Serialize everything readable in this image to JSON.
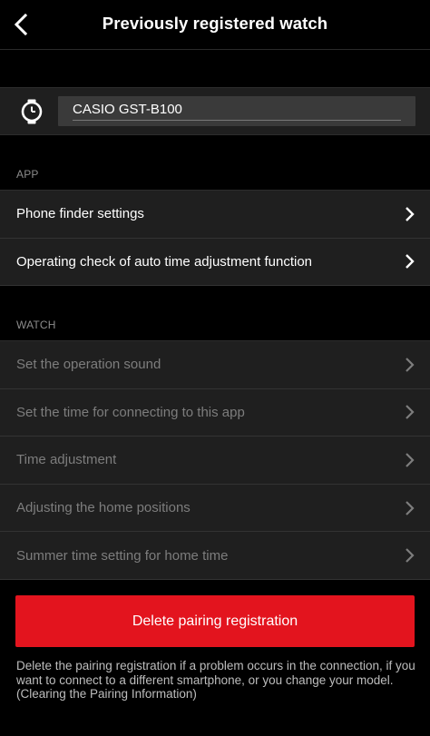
{
  "header": {
    "title": "Previously registered watch",
    "back_icon": "chevron-left-icon"
  },
  "watch": {
    "icon": "watch-icon",
    "model": "CASIO GST-B100"
  },
  "sections": {
    "app": {
      "label": "APP",
      "items": [
        {
          "label": "Phone finder settings",
          "enabled": true
        },
        {
          "label": "Operating check of auto time adjustment function",
          "enabled": true
        }
      ]
    },
    "watch": {
      "label": "WATCH",
      "items": [
        {
          "label": "Set the operation sound",
          "enabled": false
        },
        {
          "label": "Set the time for connecting to this app",
          "enabled": false
        },
        {
          "label": "Time adjustment",
          "enabled": false
        },
        {
          "label": "Adjusting the home positions",
          "enabled": false
        },
        {
          "label": "Summer time setting for home time",
          "enabled": false
        }
      ]
    }
  },
  "delete": {
    "label": "Delete pairing registration",
    "color": "#e3141e"
  },
  "note": {
    "text": "Delete the pairing registration if a problem occurs in the connection, if you want to connect to a different smartphone, or you change your model.",
    "subtext": "(Clearing the Pairing Information)"
  }
}
